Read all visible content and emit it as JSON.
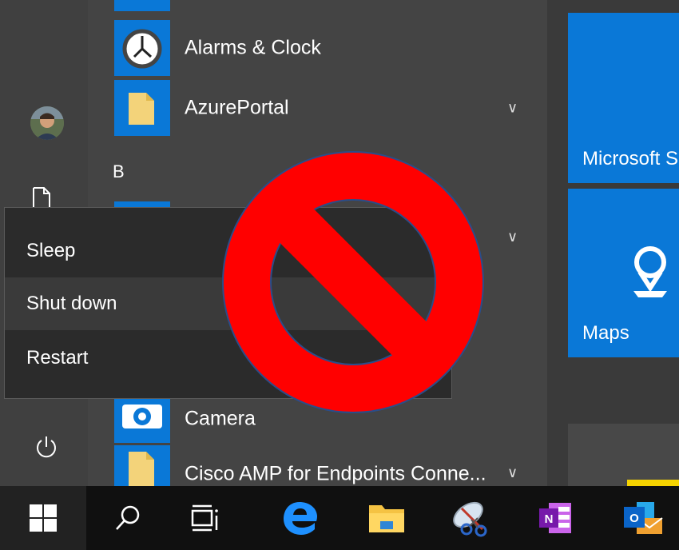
{
  "apps": [
    {
      "label": "Alarms & Clock",
      "icon": "clock-icon",
      "expandable": false
    },
    {
      "label": "AzurePortal",
      "icon": "folder-icon",
      "expandable": true
    },
    {
      "label": "Camera",
      "icon": "camera-icon",
      "expandable": false
    },
    {
      "label": "Cisco AMP for Endpoints Conne...",
      "icon": "folder-icon",
      "expandable": true
    }
  ],
  "section_letter": "B",
  "power_menu": {
    "items": [
      "Sleep",
      "Shut down",
      "Restart"
    ],
    "hovered": "Shut down"
  },
  "tiles": [
    {
      "label": "Microsoft S",
      "icon": "store-icon"
    },
    {
      "label": "Maps",
      "icon": "map-pin-icon"
    }
  ],
  "taskbar": {
    "items": [
      "start",
      "search",
      "task-view",
      "edge",
      "file-explorer",
      "snipping-tool",
      "onenote",
      "outlook"
    ]
  },
  "colors": {
    "accent": "#0a78d7",
    "no_symbol": "#ff0000",
    "menu_bg": "#2b2b2b",
    "taskbar_bg": "#101010"
  }
}
